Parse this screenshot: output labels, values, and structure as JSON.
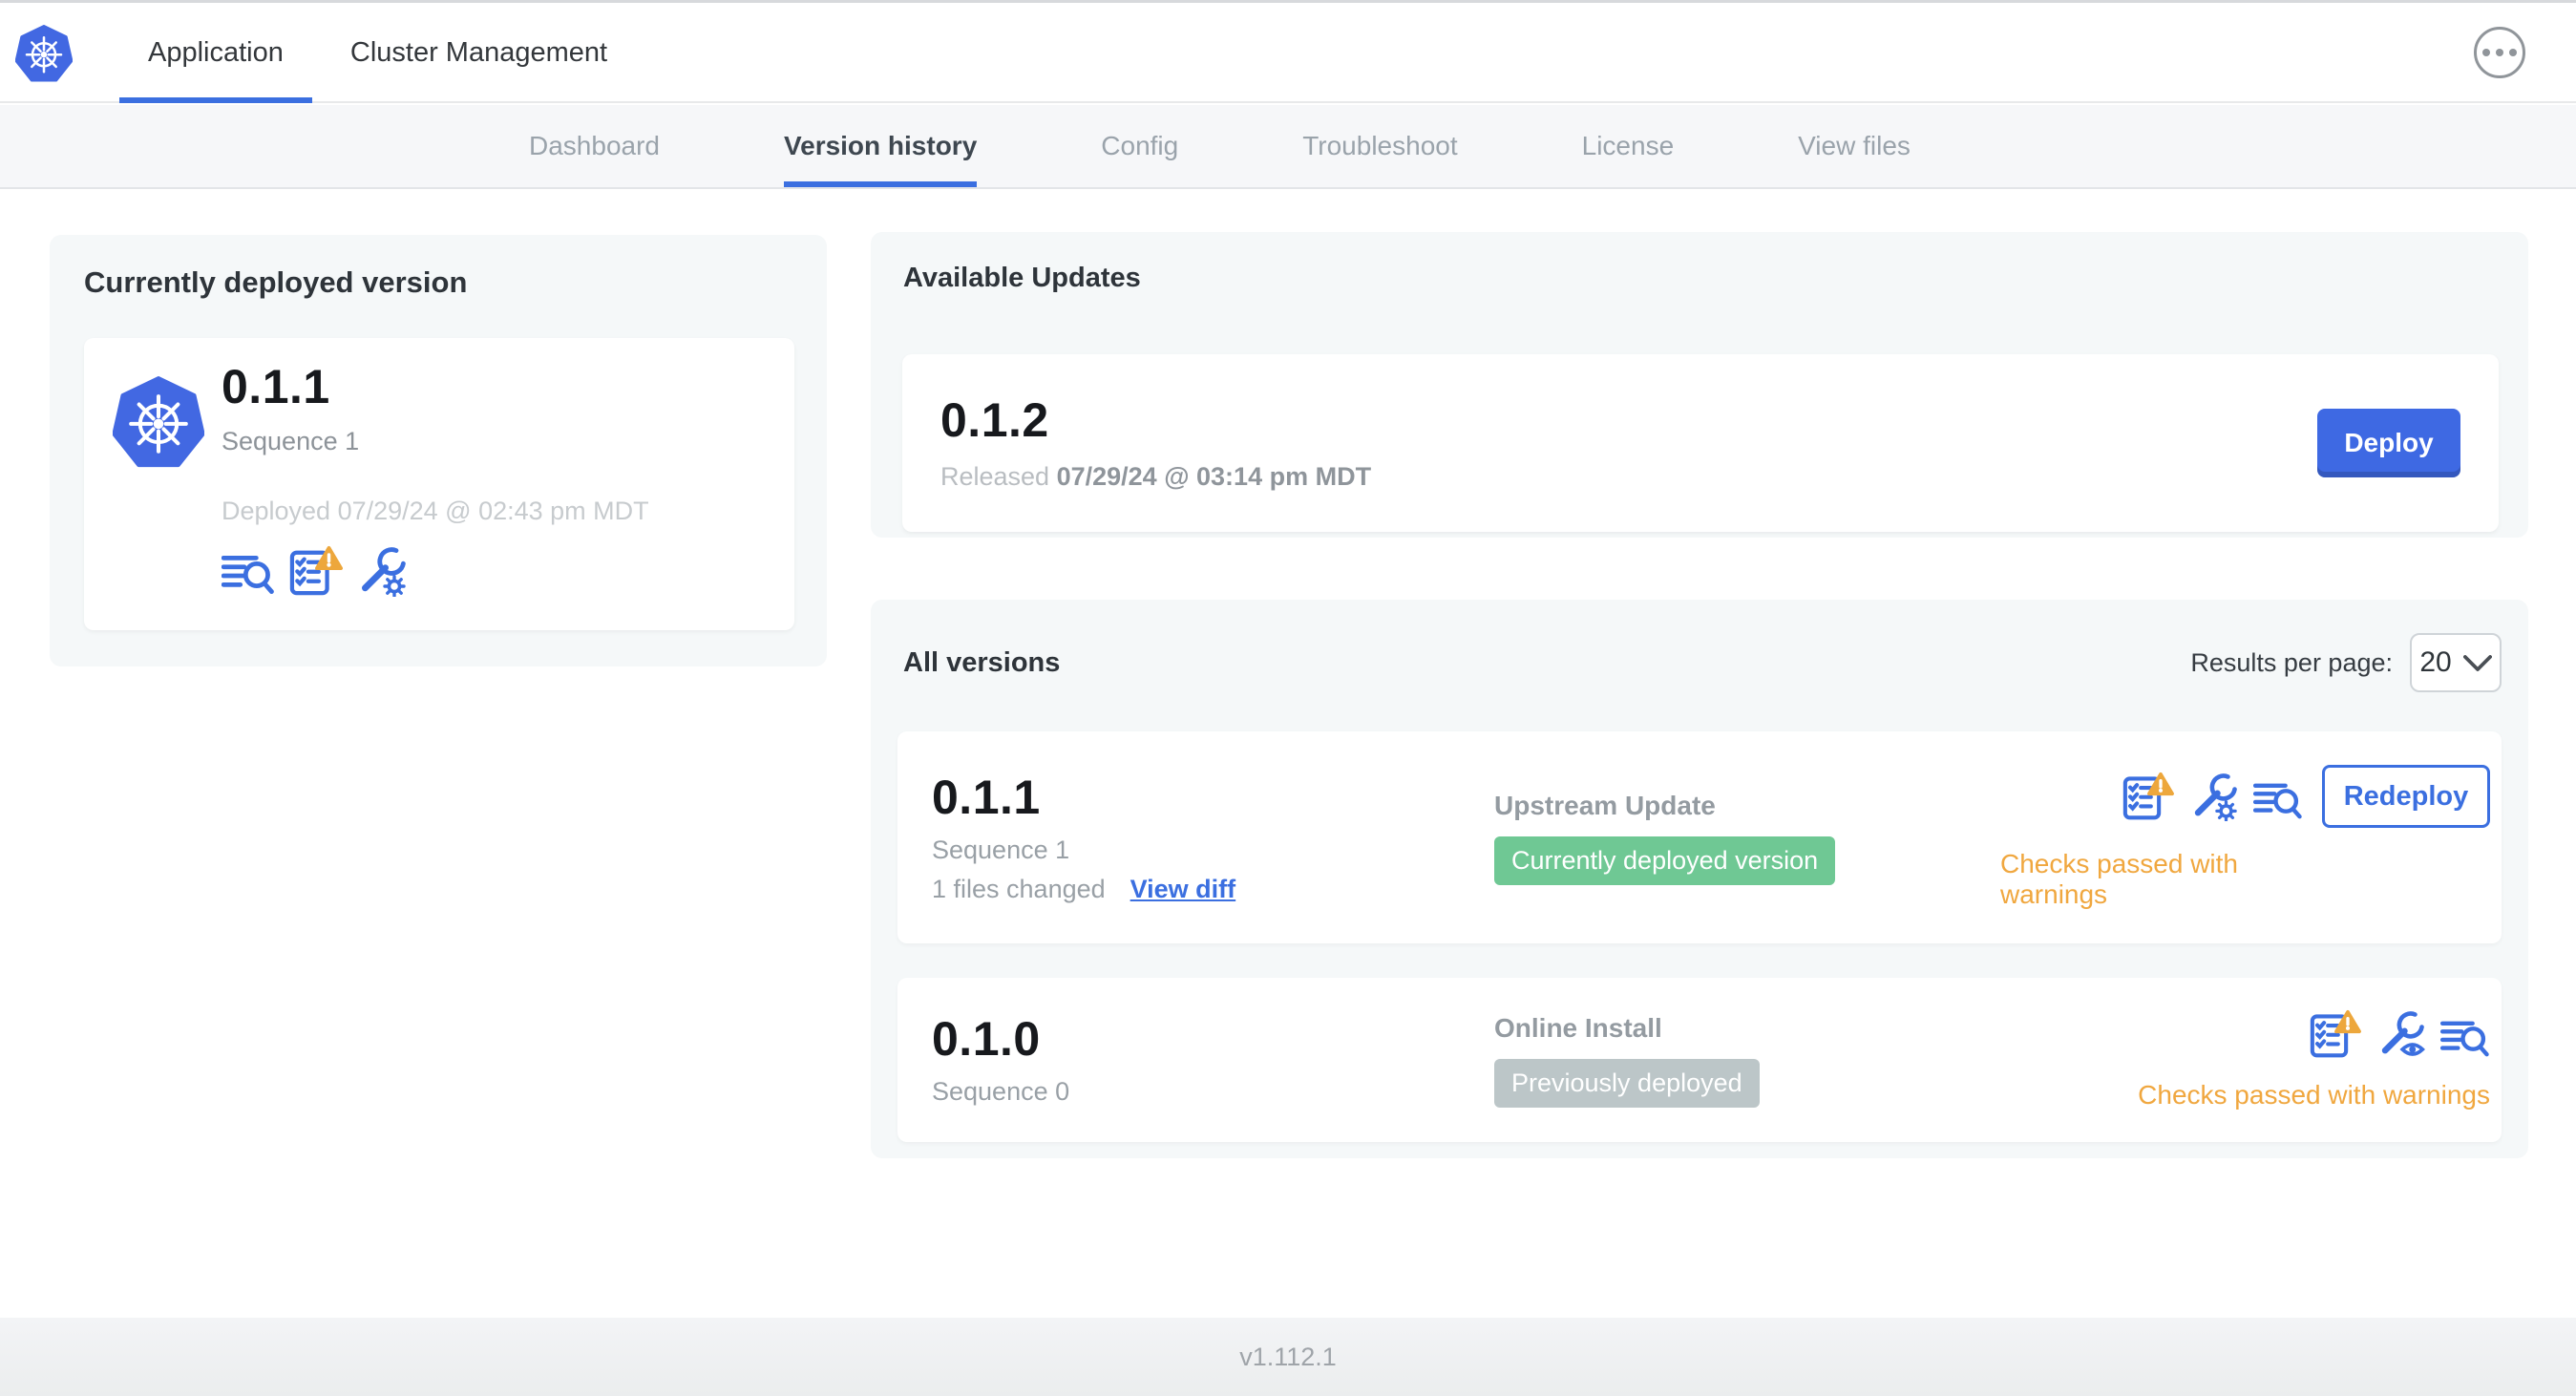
{
  "colors": {
    "accent_blue": "#3b6fe0",
    "deploy_blue": "#3e69e3",
    "k8s_blue": "#4268e2",
    "badge_green": "#6fc894",
    "badge_gray": "#bcc6c8",
    "warning_orange": "#eda73c",
    "status_orange": "#f0a73f",
    "panel_gray": "#f5f8f9"
  },
  "header": {
    "logo_icon": "kubernetes-logo-icon",
    "tabs": [
      {
        "label": "Application",
        "active": true
      },
      {
        "label": "Cluster Management",
        "active": false
      }
    ],
    "menu_icon": "ellipsis-menu-icon"
  },
  "subnav": {
    "tabs": [
      {
        "label": "Dashboard",
        "active": false
      },
      {
        "label": "Version history",
        "active": true
      },
      {
        "label": "Config",
        "active": false
      },
      {
        "label": "Troubleshoot",
        "active": false
      },
      {
        "label": "License",
        "active": false
      },
      {
        "label": "View files",
        "active": false
      }
    ]
  },
  "current_version": {
    "title": "Currently deployed version",
    "version": "0.1.1",
    "sequence": "Sequence 1",
    "deployed": "Deployed 07/29/24 @ 02:43 pm MDT",
    "icons": [
      "deploy-logs-icon",
      "preflight-checks-warning-icon",
      "edit-config-icon"
    ]
  },
  "available_updates": {
    "title": "Available Updates",
    "version": "0.1.2",
    "released_prefix": "Released",
    "released_date": "07/29/24 @ 03:14 pm MDT",
    "deploy_button": "Deploy"
  },
  "all_versions": {
    "title": "All versions",
    "results_per_page_label": "Results per page:",
    "results_per_page_value": "20",
    "rows": [
      {
        "version": "0.1.1",
        "sequence": "Sequence 1",
        "files_changed": "1 files changed",
        "view_diff": "View diff",
        "source": "Upstream Update",
        "badge_label": "Currently deployed version",
        "badge_type": "green",
        "icons": [
          "preflight-checks-warning-icon",
          "edit-config-icon",
          "deploy-logs-icon"
        ],
        "action_button": "Redeploy",
        "status": "Checks passed with warnings"
      },
      {
        "version": "0.1.0",
        "sequence": "Sequence 0",
        "source": "Online Install",
        "badge_label": "Previously deployed",
        "badge_type": "gray",
        "icons": [
          "preflight-checks-warning-icon",
          "view-config-icon",
          "deploy-logs-icon"
        ],
        "status": "Checks passed with warnings"
      }
    ]
  },
  "footer": {
    "version": "v1.112.1"
  }
}
